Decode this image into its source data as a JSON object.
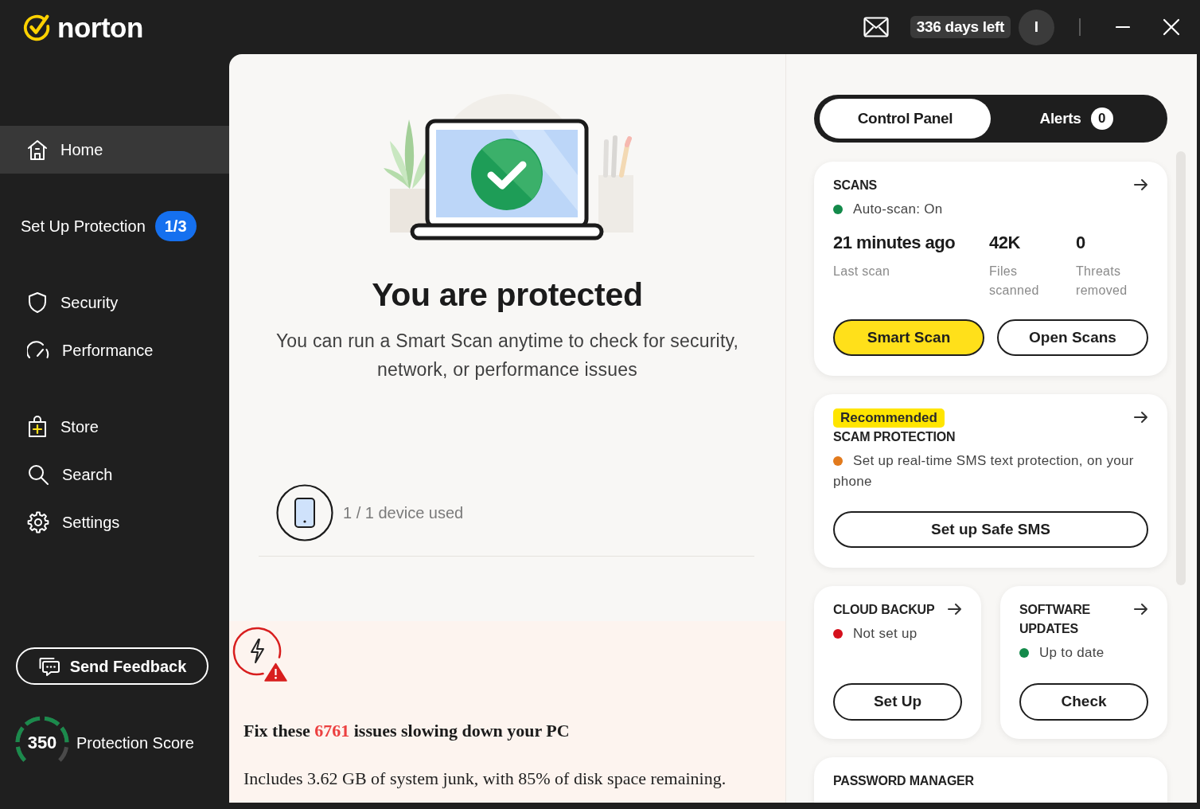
{
  "window": {
    "logo": "norton",
    "trial_badge": "336 days left",
    "avatar_initial": "I"
  },
  "sidebar": {
    "groups": [
      {
        "items": [
          {
            "label": "Home",
            "selected": true
          }
        ]
      },
      {
        "items": [
          {
            "label": "Set Up Protection",
            "badge": "1/3",
            "selected": false
          }
        ]
      },
      {
        "items": [
          {
            "label": "Security",
            "selected": false
          },
          {
            "label": "Performance",
            "selected": false
          }
        ]
      },
      {
        "items": [
          {
            "label": "Store",
            "selected": false
          },
          {
            "label": "Search",
            "selected": false
          },
          {
            "label": "Settings",
            "selected": false
          }
        ]
      }
    ],
    "feedback_button": "Send Feedback",
    "score": {
      "value": "350",
      "label": "Protection Score",
      "level": 0.85
    }
  },
  "status": {
    "title": "You are protected",
    "text": "You can run a Smart Scan anytime to check for security, network, or performance issues",
    "devices": "1 / 1 device used"
  },
  "issues": {
    "heading_start": "Fix these",
    "count": "6761",
    "heading_end": "issues slowing down your PC",
    "text": "Includes 3.62 GB of system junk, with 85% of disk space remaining."
  },
  "panel_tabs": [
    {
      "label": "Control Panel",
      "selected": true
    },
    {
      "label": "Alerts",
      "count": "0",
      "selected": false
    }
  ],
  "cards": [
    {
      "kind": "wide",
      "title": "SCANS",
      "link": true,
      "status": {
        "text": "Auto-scan: On",
        "color": "#138a4a"
      },
      "stats": [
        {
          "value": "21 minutes ago",
          "label": "Last scan"
        },
        {
          "value": "42K",
          "label": "Files scanned"
        },
        {
          "value": "0",
          "label": "Threats removed"
        }
      ],
      "buttons": [
        {
          "label": "Smart Scan",
          "primary": true
        },
        {
          "label": "Open Scans",
          "primary": false
        }
      ]
    },
    {
      "kind": "wide",
      "tag": "Recommended",
      "title": "SCAM PROTECTION",
      "link": true,
      "status": {
        "text": "Set up real-time SMS text protection, on your phone",
        "color": "#e27a1c"
      },
      "buttons": [
        {
          "label": "Set up Safe SMS",
          "primary": false
        }
      ]
    },
    {
      "kind": "half",
      "title": "CLOUD BACKUP",
      "link": true,
      "status": {
        "text": "Not set up",
        "color": "#d5101c"
      },
      "buttons": [
        {
          "label": "Set Up",
          "primary": false
        }
      ]
    },
    {
      "kind": "half",
      "title": "SOFTWARE UPDATES",
      "link": true,
      "status": {
        "text": "Up to date",
        "color": "#138a4a"
      },
      "buttons": [
        {
          "label": "Check",
          "primary": false
        }
      ]
    },
    {
      "kind": "wide",
      "title": "PASSWORD MANAGER",
      "link": false
    }
  ]
}
